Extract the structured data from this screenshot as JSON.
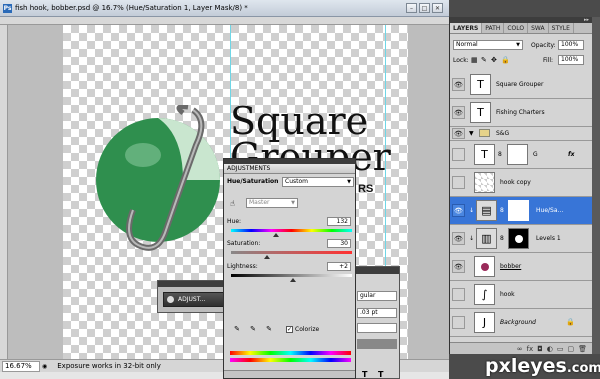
{
  "document": {
    "title": "fish hook, bobber.psd @ 16.7% (Hue/Saturation 1, Layer Mask/8) *",
    "app_icon": "Ps",
    "zoom": "16.67%",
    "status_message": "Exposure works in 32-bit only",
    "canvas_text": {
      "line1": "Square",
      "line2": "Grouper",
      "line3": "RS"
    }
  },
  "adjust_mini": {
    "label": "ADJUST..."
  },
  "adjustments": {
    "title": "ADJUSTMENTS",
    "type_label": "Hue/Saturation",
    "preset": "Custom",
    "channel": "Master",
    "hue_label": "Hue:",
    "hue_value": "132",
    "hue_level": 0.37,
    "saturation_label": "Saturation:",
    "saturation_value": "30",
    "saturation_level": 0.3,
    "lightness_label": "Lightness:",
    "lightness_value": "+2",
    "lightness_level": 0.51,
    "colorize_label": "Colorize",
    "colorize_checked": true
  },
  "character_panel": {
    "field1": "gular",
    "field2": ".03 pt",
    "tt1": "T",
    "tt2": "T"
  },
  "layers": {
    "tabs": [
      "LAYERS",
      "PATH",
      "COLO",
      "SWA",
      "STYLE"
    ],
    "blend_mode": "Normal",
    "opacity_label": "Opacity:",
    "opacity_value": "100%",
    "lock_label": "Lock:",
    "fill_label": "Fill:",
    "fill_value": "100%",
    "items": [
      {
        "name": "Square Grouper",
        "kind": "text",
        "visible": true
      },
      {
        "name": "Fishing Charters",
        "kind": "text",
        "visible": true
      },
      {
        "name": "S&G",
        "kind": "group",
        "visible": true
      },
      {
        "name": "G",
        "kind": "text",
        "visible": false,
        "fx": "fx"
      },
      {
        "name": "hook copy",
        "kind": "pixel",
        "visible": false
      },
      {
        "name": "Hue/Sa...",
        "kind": "adjustment",
        "visible": true,
        "selected": true
      },
      {
        "name": "Levels 1",
        "kind": "adjustment",
        "visible": true
      },
      {
        "name": "bobber",
        "kind": "pixel",
        "visible": true
      },
      {
        "name": "hook",
        "kind": "pixel",
        "visible": false
      },
      {
        "name": "Background",
        "kind": "background",
        "visible": false
      }
    ]
  },
  "watermark": {
    "brand": "pxleyes",
    "suffix": ".com"
  },
  "colors": {
    "selection": "#3875d7",
    "panel": "#d4d4d4",
    "dark_bar": "#3d3d3d",
    "bobber_green": "#2f8f4e"
  }
}
